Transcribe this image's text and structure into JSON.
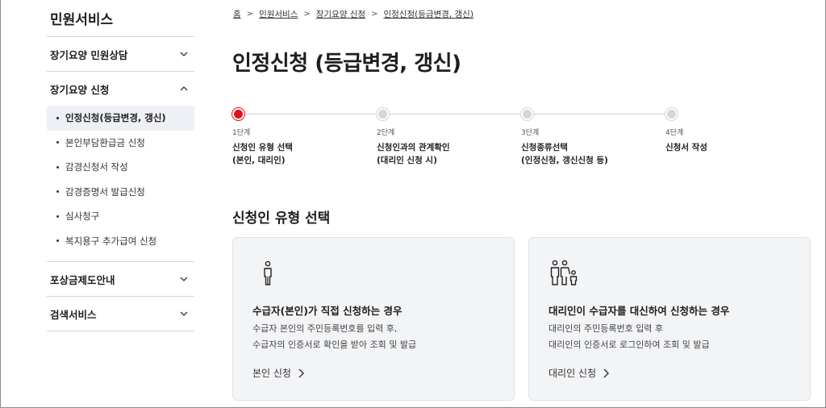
{
  "sidebar": {
    "title": "민원서비스",
    "sections": [
      {
        "label": "장기요양 민원상담",
        "expanded": false
      },
      {
        "label": "장기요양 신청",
        "expanded": true,
        "items": [
          {
            "label": "인정신청(등급변경, 갱신)",
            "active": true
          },
          {
            "label": "본인부담환급금 신청"
          },
          {
            "label": "감경신청서 작성"
          },
          {
            "label": "감경증명서 발급신청"
          },
          {
            "label": "심사청구"
          },
          {
            "label": "복지용구 추가급여 신청"
          }
        ]
      },
      {
        "label": "포상금제도안내",
        "expanded": false
      },
      {
        "label": "검색서비스",
        "expanded": false
      }
    ]
  },
  "breadcrumb": [
    "홈",
    "민원서비스",
    "장기요양 신청",
    "인정신청(등급변경, 갱신)"
  ],
  "page_title": "인정신청 (등급변경, 갱신)",
  "steps": [
    {
      "num": "1단계",
      "label": "신청인 유형 선택\n(본인, 대리인)",
      "current": true
    },
    {
      "num": "2단계",
      "label": "신청인과의 관계확인\n(대리인 신청 시)"
    },
    {
      "num": "3단계",
      "label": "신청종류선택\n(인정신청, 갱신신청 등)"
    },
    {
      "num": "4단계",
      "label": "신청서 작성"
    }
  ],
  "section_title": "신청인 유형 선택",
  "cards": [
    {
      "icon": "person-icon",
      "title": "수급자(본인)가 직접 신청하는 경우",
      "desc1": "수급자 본인의 주민등록번호를 입력 후,",
      "desc2": "수급자의 인증서로 확인을 받아 조회 및 발급",
      "link": "본인 신청"
    },
    {
      "icon": "family-icon",
      "title": "대리인이 수급자를 대신하여 신청하는 경우",
      "desc1": "대리인의 주민등록번호 입력 후",
      "desc2": "대리인의 인증서로 로그인하여 조회 및 발급",
      "link": "대리인 신청"
    }
  ],
  "colors": {
    "accent": "#e0121c",
    "card_bg": "#f3f4f6",
    "active_bg": "#eef0f5"
  }
}
